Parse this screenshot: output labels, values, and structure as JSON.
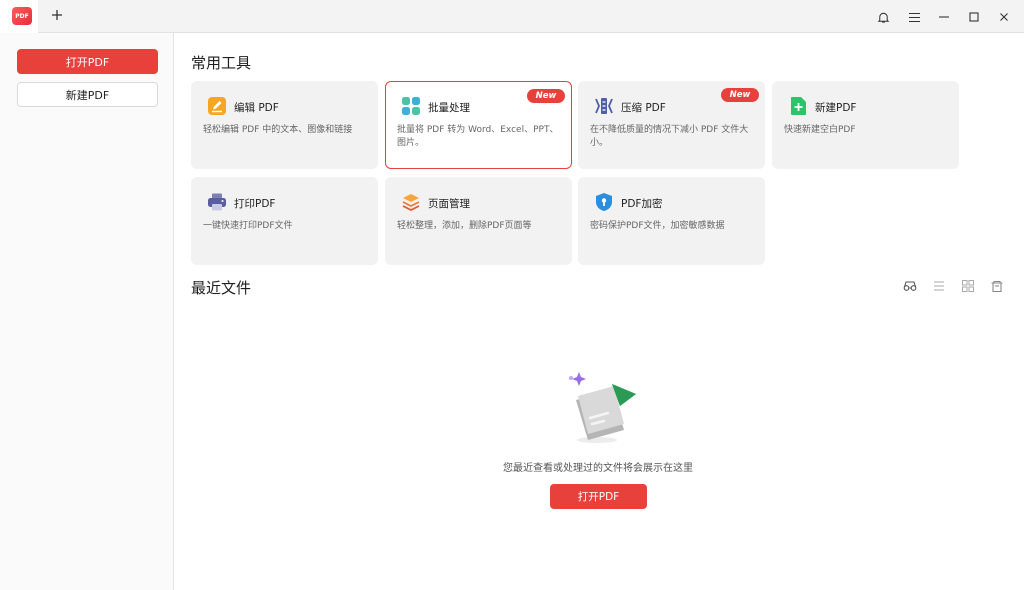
{
  "app": {
    "logo_text": "PDF",
    "brand_color": "#e8413c"
  },
  "sidebar": {
    "open_pdf": "打开PDF",
    "new_pdf": "新建PDF"
  },
  "tools": {
    "title": "常用工具",
    "new_badge": "New",
    "items": [
      {
        "name": "编辑 PDF",
        "desc": "轻松编辑 PDF 中的文本、图像和链接",
        "icon": "edit-icon"
      },
      {
        "name": "批量处理",
        "desc": "批量将 PDF 转为 Word、Excel、PPT、图片。",
        "icon": "batch-icon",
        "badge": true,
        "selected": true
      },
      {
        "name": "压缩 PDF",
        "desc": "在不降低质量的情况下减小 PDF 文件大小。",
        "icon": "compress-icon",
        "badge": true
      },
      {
        "name": "新建PDF",
        "desc": "快速新建空白PDF",
        "icon": "new-pdf-icon"
      },
      {
        "name": "打印PDF",
        "desc": "一键快速打印PDF文件",
        "icon": "print-icon"
      },
      {
        "name": "页面管理",
        "desc": "轻松整理，添加，删除PDF页面等",
        "icon": "page-manage-icon"
      },
      {
        "name": "PDF加密",
        "desc": "密码保护PDF文件，加密敏感数据",
        "icon": "lock-shield-icon"
      }
    ]
  },
  "recent": {
    "title": "最近文件",
    "empty_text": "您最近查看或处理过的文件将会展示在这里",
    "open_button": "打开PDF"
  }
}
